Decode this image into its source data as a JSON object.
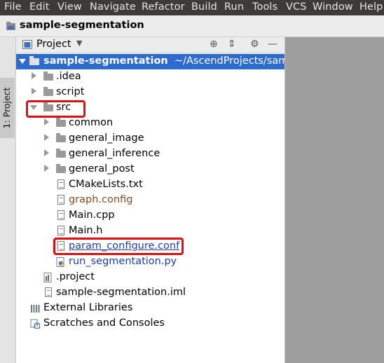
{
  "menu": [
    "File",
    "Edit",
    "View",
    "Navigate",
    "Refactor",
    "Build",
    "Run",
    "Tools",
    "VCS",
    "Window",
    "Help"
  ],
  "breadcrumb": {
    "project_name": "sample-segmentation"
  },
  "tool_stripe": {
    "label": "1: Project"
  },
  "panel": {
    "title": "Project",
    "caret": "▼",
    "buttons": {
      "locate": "⊕",
      "collapse": "⇕",
      "settings": "⚙",
      "hide": "—"
    }
  },
  "tree": {
    "root": {
      "name": "sample-segmentation",
      "path": "~/AscendProjects/sample-segmentation"
    },
    "idea": ".idea",
    "script": "script",
    "src": "src",
    "common": "common",
    "general_image": "general_image",
    "general_inference": "general_inference",
    "general_post": "general_post",
    "cmake": "CMakeLists.txt",
    "graph": "graph.config",
    "main_cpp": "Main.cpp",
    "main_h": "Main.h",
    "param": "param_configure.conf",
    "run_py": "run_segmentation.py",
    "project_file": ".project",
    "iml": "sample-segmentation.iml",
    "ext_libs": "External Libraries",
    "scratches": "Scratches and Consoles"
  },
  "colors": {
    "selection": "#2e6bd1",
    "highlight_box": "#e01010",
    "modified_file": "#8a4b1c",
    "new_file": "#1a3fb3",
    "menubar": "#3c3b37"
  }
}
